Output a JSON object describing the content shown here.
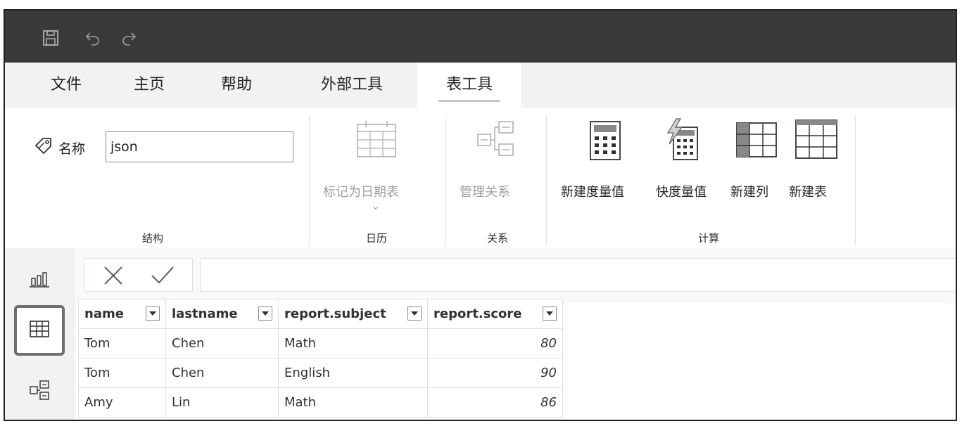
{
  "ribbon_tabs": [
    {
      "label": "文件"
    },
    {
      "label": "主页"
    },
    {
      "label": "帮助"
    },
    {
      "label": "外部工具"
    },
    {
      "label": "表工具",
      "active": true
    }
  ],
  "structure": {
    "name_label": "名称",
    "name_value": "json",
    "group_label": "结构"
  },
  "calendar": {
    "mark_as_date_table": "标记为日期表",
    "dropdown_glyph": "⌄",
    "group_label": "日历"
  },
  "relations": {
    "manage_relations": "管理关系",
    "group_label": "关系"
  },
  "calculations": {
    "new_measure": "新建度量值",
    "quick_measure": "快度量值",
    "new_column": "新建列",
    "new_table": "新建表",
    "group_label": "计算"
  },
  "table": {
    "columns": [
      "name",
      "lastname",
      "report.subject",
      "report.score"
    ],
    "rows": [
      [
        "Tom",
        "Chen",
        "Math",
        "80"
      ],
      [
        "Tom",
        "Chen",
        "English",
        "90"
      ],
      [
        "Amy",
        "Lin",
        "Math",
        "86"
      ]
    ]
  },
  "icons": {
    "titlebar": [
      "save-icon",
      "undo-icon",
      "redo-icon"
    ],
    "views": [
      "report-view-icon",
      "data-view-icon",
      "model-view-icon"
    ]
  },
  "colors": {
    "titlebar": "#3b3a39",
    "ribbon_tabs_bg": "#f3f2f1",
    "disabled_text": "#a19f9d"
  }
}
